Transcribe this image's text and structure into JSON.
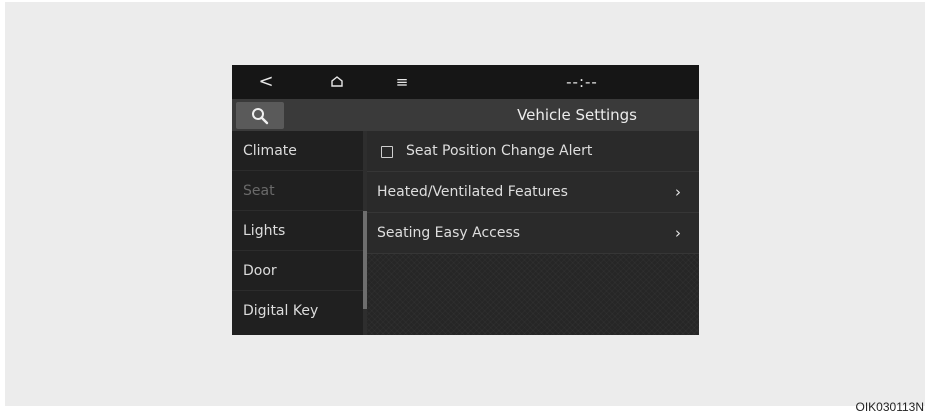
{
  "topbar": {
    "back_icon": "chevron-left-icon",
    "back_glyph": "<",
    "home_icon": "home-icon",
    "menu_icon": "menu-icon",
    "menu_glyph": "≡",
    "clock": "--:--"
  },
  "titlebar": {
    "search_icon": "search-icon",
    "title": "Vehicle Settings"
  },
  "sidebar": {
    "items": [
      {
        "label": "Climate",
        "state": "normal"
      },
      {
        "label": "Seat",
        "state": "selected"
      },
      {
        "label": "Lights",
        "state": "normal"
      },
      {
        "label": "Door",
        "state": "normal"
      },
      {
        "label": "Digital Key",
        "state": "normal"
      }
    ]
  },
  "content": {
    "rows": [
      {
        "label": "Seat Position Change Alert",
        "type": "checkbox",
        "checked": false
      },
      {
        "label": "Heated/Ventilated Features",
        "type": "submenu",
        "chevron": "›"
      },
      {
        "label": "Seating Easy Access",
        "type": "submenu",
        "chevron": "›"
      }
    ]
  },
  "caption": "OIK030113N",
  "colors": {
    "screen_bg": "#2a2a2a",
    "topbar_bg": "#161616",
    "titlebar_bg": "#3a3a3a",
    "sidebar_bg": "#202020",
    "selected_text": "#6a6a6a"
  }
}
